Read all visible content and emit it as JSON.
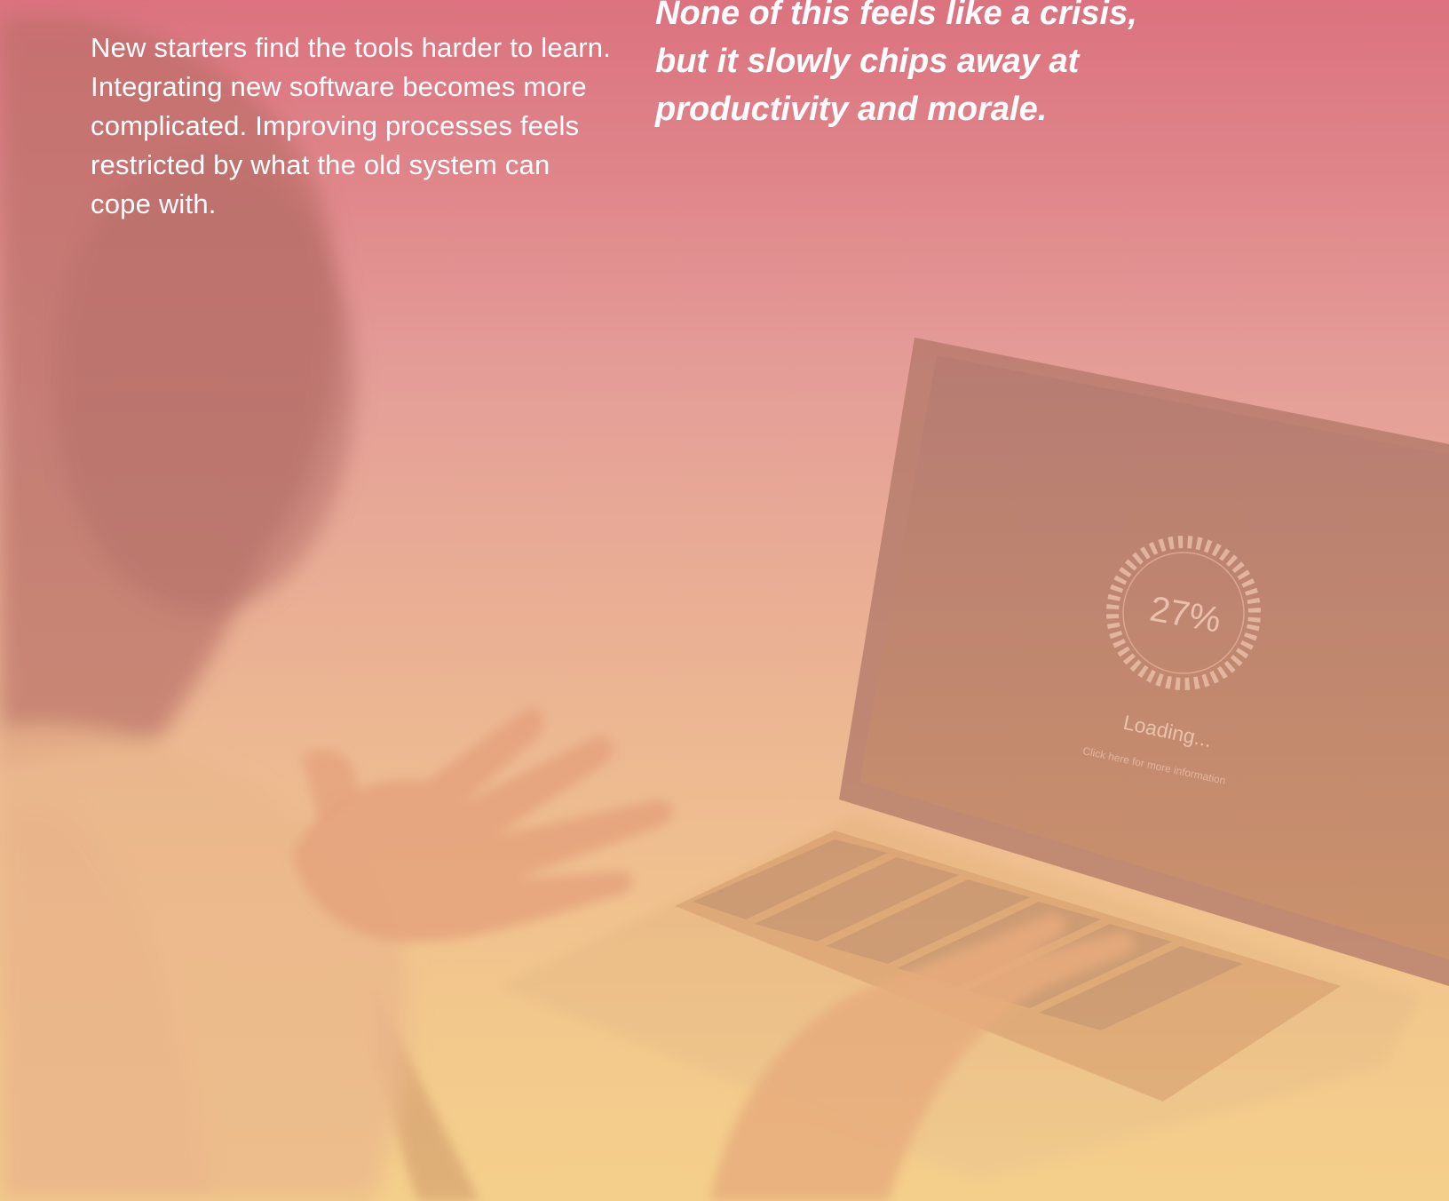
{
  "text": {
    "body_paragraph": "New starters find the tools harder to learn. Integrating new software becomes more complicated. Improving processes feels restricted by what the old system can cope with.",
    "pull_quote": "None of this feels like a crisis, but it slowly chips away at productivity and morale."
  },
  "laptop_screen": {
    "progress_value": "27%",
    "progress_fraction": 0.27,
    "status_text": "Loading...",
    "hint_text": "Click here for more information"
  },
  "colors": {
    "gradient_top": "#db7480",
    "gradient_bottom": "#f4cf8b",
    "text": "#ffffff"
  }
}
